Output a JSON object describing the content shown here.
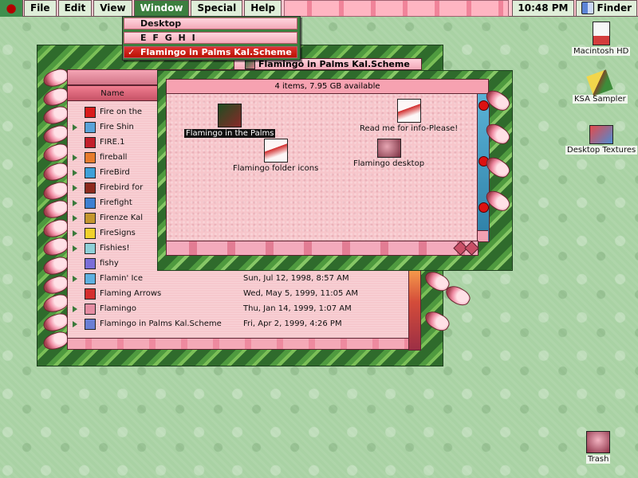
{
  "menubar": {
    "apple": "",
    "items": [
      "File",
      "Edit",
      "View",
      "Window",
      "Special",
      "Help"
    ],
    "clock": "10:48 PM",
    "app": "Finder"
  },
  "window_menu": {
    "items": [
      {
        "label": "Desktop",
        "checked": false
      },
      {
        "label": "E F G H I",
        "checked": false
      },
      {
        "label": "Flamingo in Palms Kal.Scheme",
        "checked": true
      }
    ],
    "check": "✓"
  },
  "front_window": {
    "title": "Flamingo in Palms Kal.Scheme",
    "info": "4 items, 7.95 GB available",
    "icons": [
      {
        "label": "Flamingo in the Palms",
        "selected": true
      },
      {
        "label": "Read me for info-Please!",
        "selected": false
      },
      {
        "label": "Flamingo folder icons",
        "selected": false
      },
      {
        "label": "Flamingo desktop",
        "selected": false
      }
    ]
  },
  "list_window": {
    "column_name": "Name",
    "rows": [
      {
        "name": "Fire on the",
        "date": "",
        "expand": false,
        "color": "#d81c1c"
      },
      {
        "name": "Fire Shin",
        "date": "",
        "expand": true,
        "color": "#5aa3d9"
      },
      {
        "name": "FIRE.1",
        "date": "",
        "expand": false,
        "color": "#c21e2b"
      },
      {
        "name": "fireball",
        "date": "",
        "expand": true,
        "color": "#e77b2d"
      },
      {
        "name": "FireBird",
        "date": "",
        "expand": true,
        "color": "#3ea0d8"
      },
      {
        "name": "Firebird for",
        "date": "",
        "expand": true,
        "color": "#8d2a1e"
      },
      {
        "name": "Firefight",
        "date": "",
        "expand": true,
        "color": "#3d7fd1"
      },
      {
        "name": "Firenze Kal",
        "date": "",
        "expand": true,
        "color": "#c4962e"
      },
      {
        "name": "FireSigns",
        "date": "",
        "expand": true,
        "color": "#f0d12c"
      },
      {
        "name": "Fishies!",
        "date": "",
        "expand": true,
        "color": "#8fd0d8"
      },
      {
        "name": "fishy",
        "date": "",
        "expand": false,
        "color": "#7a6ed8"
      },
      {
        "name": "Flamin' Ice",
        "date": "Sun, Jul 12, 1998, 8:57 AM",
        "expand": true,
        "color": "#5fb0e0"
      },
      {
        "name": "Flaming Arrows",
        "date": "Wed, May 5, 1999, 11:05 AM",
        "expand": false,
        "color": "#d42d2d"
      },
      {
        "name": "Flamingo",
        "date": "Thu, Jan 14, 1999, 1:07 AM",
        "expand": true,
        "color": "#e58ca2"
      },
      {
        "name": "Flamingo in Palms Kal.Scheme",
        "date": "Fri, Apr 2, 1999, 4:26 PM",
        "expand": true,
        "color": "#6a7fd4"
      }
    ]
  },
  "desktop": {
    "icons": [
      {
        "label": "Macintosh HD"
      },
      {
        "label": "KSA Sampler"
      },
      {
        "label": "Desktop Textures"
      },
      {
        "label": "Trash"
      }
    ]
  }
}
